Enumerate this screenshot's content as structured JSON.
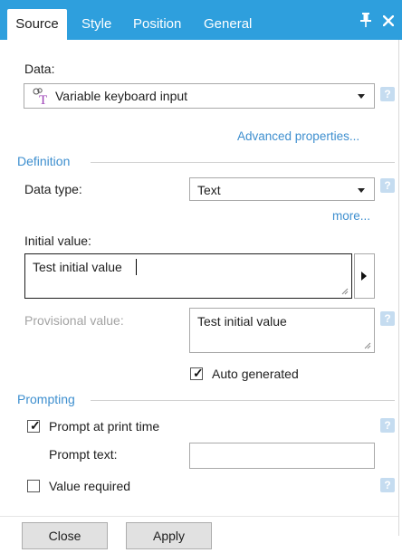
{
  "tabs": [
    "Source",
    "Style",
    "Position",
    "General"
  ],
  "icons": {
    "pin": "pin-icon",
    "close": "close-icon",
    "variable": "variable-keyboard-input-icon",
    "help": "help-icon"
  },
  "colors": {
    "accent": "#2e9fdd",
    "link": "#3e8fcf",
    "help": "#c5dcf0"
  },
  "data": {
    "label": "Data:",
    "value": "Variable keyboard input",
    "advanced_link": "Advanced properties..."
  },
  "definition": {
    "title": "Definition",
    "data_type_label": "Data type:",
    "data_type_value": "Text",
    "more_link": "more...",
    "initial_value_label": "Initial value:",
    "initial_value": "Test initial value",
    "provisional_label": "Provisional value:",
    "provisional_value": "Test initial value",
    "auto_generated_label": "Auto generated",
    "auto_generated_checked": true
  },
  "prompting": {
    "title": "Prompting",
    "prompt_at_print_label": "Prompt at print time",
    "prompt_at_print_checked": true,
    "prompt_text_label": "Prompt text:",
    "prompt_text_value": "",
    "value_required_label": "Value required",
    "value_required_checked": false
  },
  "footer": {
    "close_label": "Close",
    "apply_label": "Apply"
  }
}
